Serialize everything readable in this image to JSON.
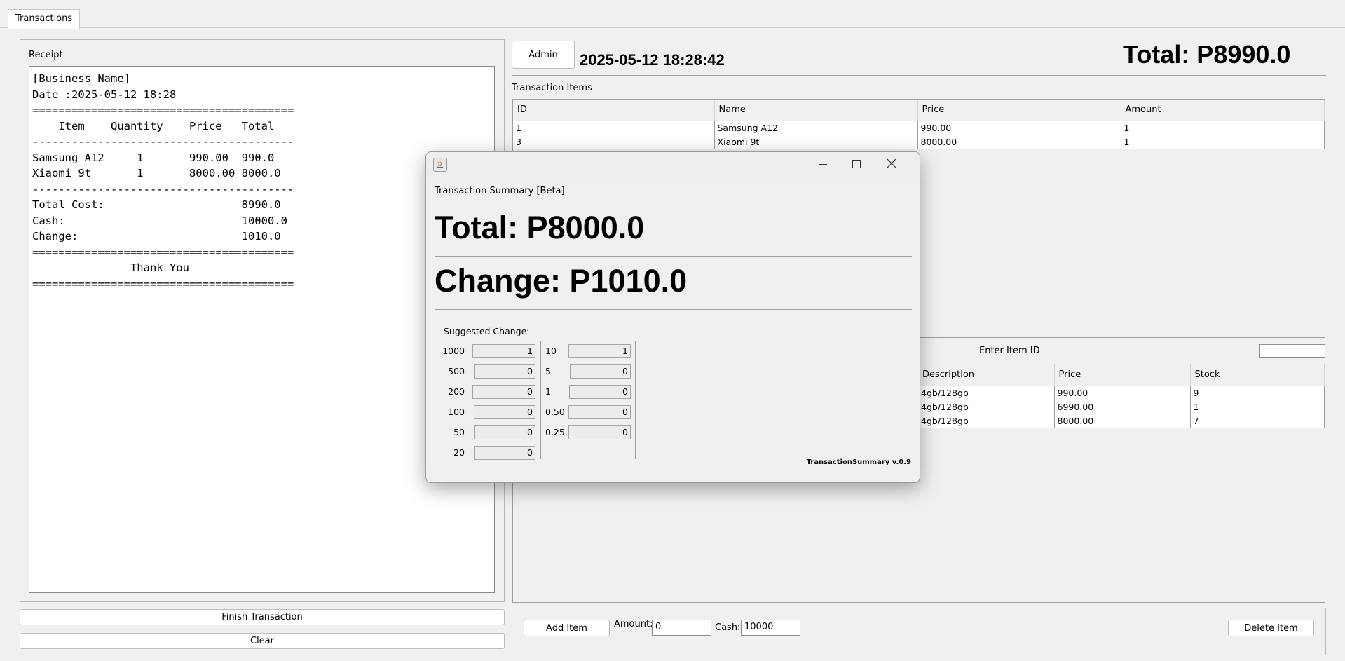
{
  "tabs": [
    "Transactions"
  ],
  "receipt": {
    "label": "Receipt",
    "text": "[Business Name]\nDate :2025-05-12 18:28\n========================================\n    Item    Quantity    Price   Total\n----------------------------------------\nSamsung A12     1       990.00  990.0\nXiaomi 9t       1       8000.00 8000.0\n----------------------------------------\nTotal Cost:                     8990.0\nCash:                           10000.0\nChange:                         1010.0\n========================================\n               Thank You\n========================================"
  },
  "buttons": {
    "finish": "Finish Transaction",
    "clear": "Clear",
    "admin": "Admin",
    "add_item": "Add Item",
    "delete_item": "Delete Item"
  },
  "header": {
    "datetime": "2025-05-12 18:28:42",
    "total": "Total: P8990.0"
  },
  "transaction_items": {
    "label": "Transaction Items",
    "columns": [
      "ID",
      "Name",
      "Price",
      "Amount"
    ],
    "rows": [
      [
        "1",
        "Samsung A12",
        "990.00",
        "1"
      ],
      [
        "3",
        "Xiaomi 9t",
        "8000.00",
        "1"
      ]
    ]
  },
  "item_search": {
    "label": "Enter Item ID",
    "value": ""
  },
  "inventory": {
    "columns": [
      "Description",
      "Price",
      "Stock"
    ],
    "rows": [
      [
        "4gb/128gb",
        "990.00",
        "9"
      ],
      [
        "4gb/128gb",
        "6990.00",
        "1"
      ],
      [
        "4gb/128gb",
        "8000.00",
        "7"
      ]
    ]
  },
  "bottom_bar": {
    "amount_label": "Amount:",
    "amount_value": "0",
    "cash_label": "Cash:",
    "cash_value": "10000"
  },
  "dialog": {
    "section_title": "Transaction Summary [Beta]",
    "total": "Total: P8000.0",
    "change": "Change: P1010.0",
    "suggested_label": "Suggested Change:",
    "denominations_left": [
      {
        "denom": "1000",
        "count": "1"
      },
      {
        "denom": "500",
        "count": "0"
      },
      {
        "denom": "200",
        "count": "0"
      },
      {
        "denom": "100",
        "count": "0"
      },
      {
        "denom": "50",
        "count": "0"
      },
      {
        "denom": "20",
        "count": "0"
      }
    ],
    "denominations_right": [
      {
        "denom": "10",
        "count": "1"
      },
      {
        "denom": "5",
        "count": "0"
      },
      {
        "denom": "1",
        "count": "0"
      },
      {
        "denom": "0.50",
        "count": "0"
      },
      {
        "denom": "0.25",
        "count": "0"
      }
    ],
    "version": "TransactionSummary v.0.9"
  }
}
